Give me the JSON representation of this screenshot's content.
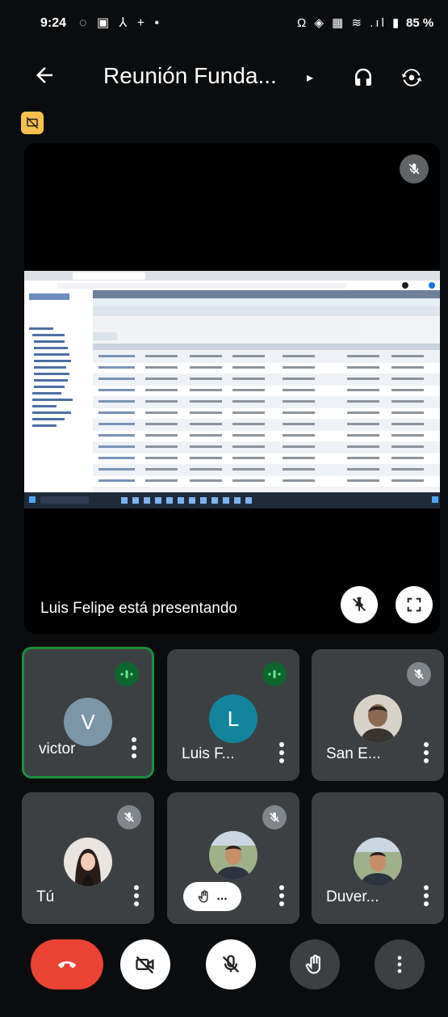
{
  "status_bar": {
    "time": "9:24",
    "left_icons": "◌ ▣ ⅄ + •",
    "right_icons": "Ω ◈ ▦ ≋ .ıl ▮",
    "battery": "85 %"
  },
  "header": {
    "title": "Reunión Funda...",
    "caret": "▸",
    "icons": [
      "back-arrow-icon",
      "headphones-icon",
      "switch-camera-icon"
    ]
  },
  "no_present_icon": "presentation-off-icon",
  "stage": {
    "presenter_text": "Luis Felipe está presentando",
    "muted": true
  },
  "participants": [
    {
      "name": "victor",
      "initial": "V",
      "avatar_color": "#7c96a8",
      "speaking": true,
      "badge": "audio"
    },
    {
      "name": "Luis F...",
      "initial": "L",
      "avatar_color": "#12859c",
      "speaking": false,
      "badge": "audio"
    },
    {
      "name": "San E...",
      "initial": "",
      "avatar_color": "#8a7a66",
      "speaking": false,
      "badge": "muted"
    },
    {
      "name": "Tú",
      "initial": "",
      "avatar_color": "#3a2e2a",
      "speaking": false,
      "badge": "muted"
    },
    {
      "name": "",
      "initial": "",
      "avatar_color": "#5a6a4c",
      "speaking": false,
      "badge": "muted",
      "hand_raised": "..."
    },
    {
      "name": "Duver...",
      "initial": "",
      "avatar_color": "#5a6a4c",
      "speaking": false,
      "badge": "none"
    }
  ],
  "controls": [
    "end-call",
    "camera-off",
    "mic-off",
    "raise-hand",
    "more-options"
  ],
  "colors": {
    "end_call": "#ea4335",
    "chip_yellow": "#f6c04f",
    "speaking_green": "#1e8e3e",
    "tile_bg": "#3c4043"
  }
}
